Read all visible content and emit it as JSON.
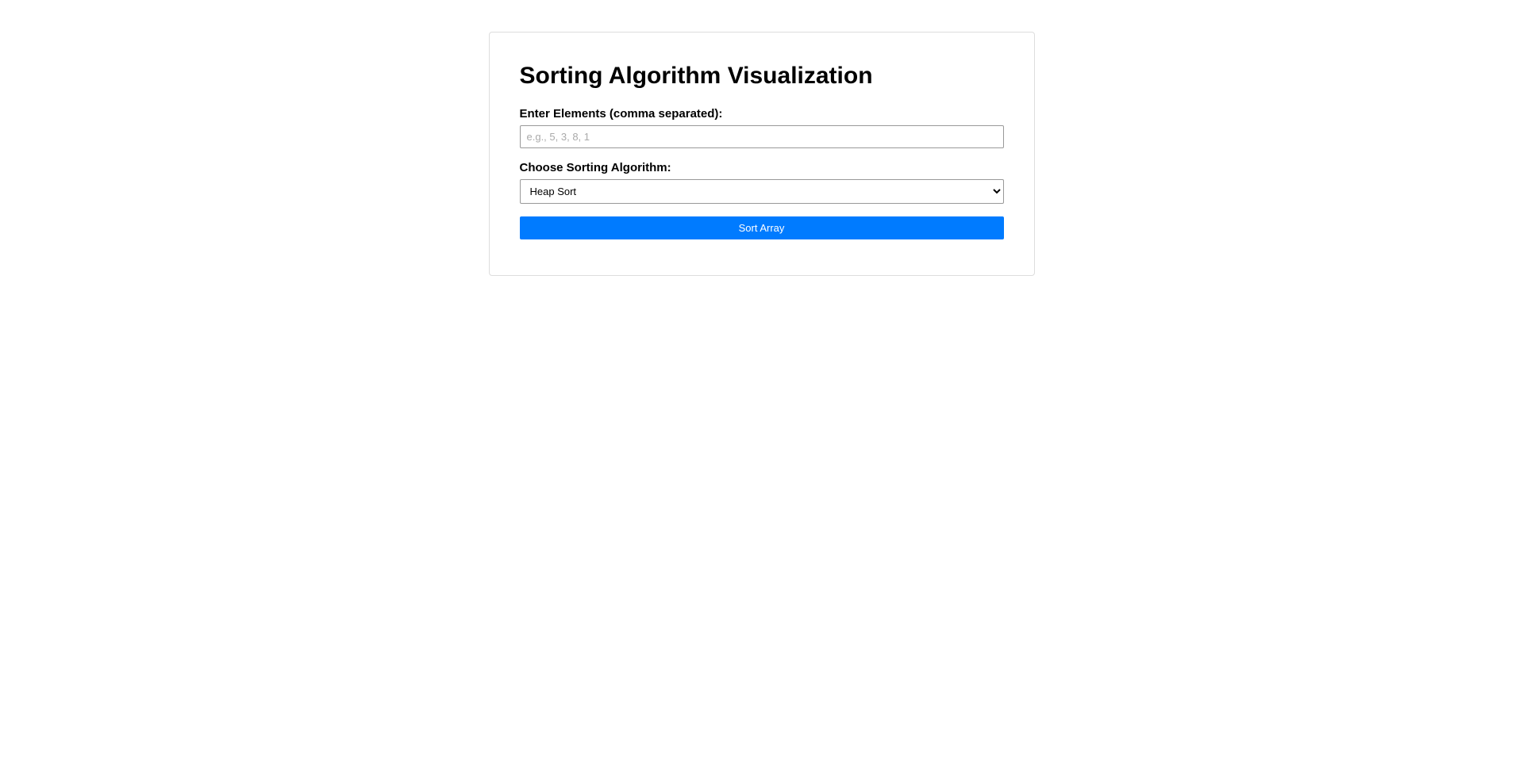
{
  "title": "Sorting Algorithm Visualization",
  "elements": {
    "label": "Enter Elements (comma separated):",
    "placeholder": "e.g., 5, 3, 8, 1",
    "value": ""
  },
  "algorithm": {
    "label": "Choose Sorting Algorithm:",
    "selected": "Heap Sort"
  },
  "button": {
    "label": "Sort Array"
  }
}
